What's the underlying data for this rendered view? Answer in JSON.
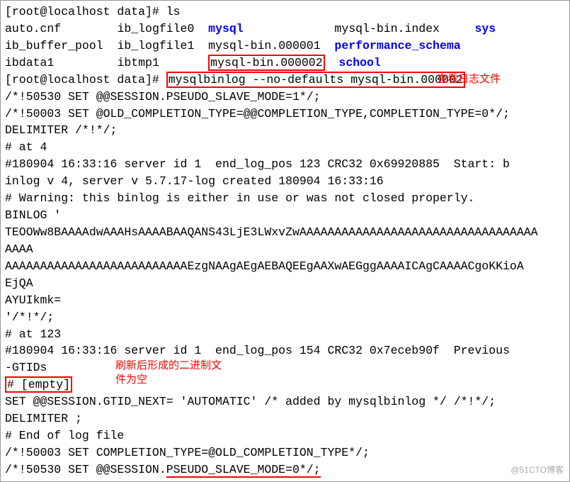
{
  "prompt1": "[root@localhost data]# ls",
  "ls_output": {
    "r1": {
      "c1": "auto.cnf",
      "c2": "ib_logfile0",
      "c3": "mysql",
      "c4": "mysql-bin.index",
      "c5": "sys"
    },
    "r2": {
      "c1": "ib_buffer_pool",
      "c2": "ib_logfile1",
      "c3": "mysql-bin.000001",
      "c4": "performance_schema"
    },
    "r3": {
      "c1": "ibdata1",
      "c2": "ibtmp1",
      "c3": "mysql-bin.000002",
      "c4": "school"
    }
  },
  "prompt2_prefix": "[root@localhost data]# ",
  "prompt2_cmd": "mysqlbinlog --no-defaults mysql-bin.000002",
  "annotation1": "查看日志文件",
  "binlog": {
    "l1": "/*!50530 SET @@SESSION.PSEUDO_SLAVE_MODE=1*/;",
    "l2": "/*!50003 SET @OLD_COMPLETION_TYPE=@@COMPLETION_TYPE,COMPLETION_TYPE=0*/;",
    "l3": "DELIMITER /*!*/;",
    "l4": "# at 4",
    "l5": "#180904 16:33:16 server id 1  end_log_pos 123 CRC32 0x69920885  Start: b",
    "l5b": "inlog v 4, server v 5.7.17-log created 180904 16:33:16",
    "l6": "# Warning: this binlog is either in use or was not closed properly.",
    "l7": "BINLOG '",
    "l8": "TEOOWw8BAAAAdwAAAHsAAAABAAQANS43LjE3LWxvZwAAAAAAAAAAAAAAAAAAAAAAAAAAAAAAAAAA",
    "l8b": "AAAA",
    "l9": "AAAAAAAAAAAAAAAAAAAAAAAAAAEzgNAAgAEgAEBAQEEgAAXwAEGggAAAAICAgCAAAACgoKKioA",
    "l9b": "EjQA",
    "l10": "AYUIkmk=",
    "l11": "'/*!*/;",
    "l12": "# at 123",
    "l13": "#180904 16:33:16 server id 1  end_log_pos 154 CRC32 0x7eceb90f  Previous",
    "l13b": "-GTIDs",
    "l14_boxed": "# [empty]",
    "l15": "SET @@SESSION.GTID_NEXT= 'AUTOMATIC' /* added by mysqlbinlog */ /*!*/;",
    "l16": "DELIMITER ;",
    "l17": "# End of log file",
    "l18": "/*!50003 SET COMPLETION_TYPE=@OLD_COMPLETION_TYPE*/;",
    "l19_prefix": "/*!50530 SET @@SESSION.",
    "l19_under": "PSEUDO_SLAVE_MODE=0*/;"
  },
  "annotation2_line1": "刷新后形成的二进制文",
  "annotation2_line2": "件为空",
  "watermark": "@51CTO博客"
}
